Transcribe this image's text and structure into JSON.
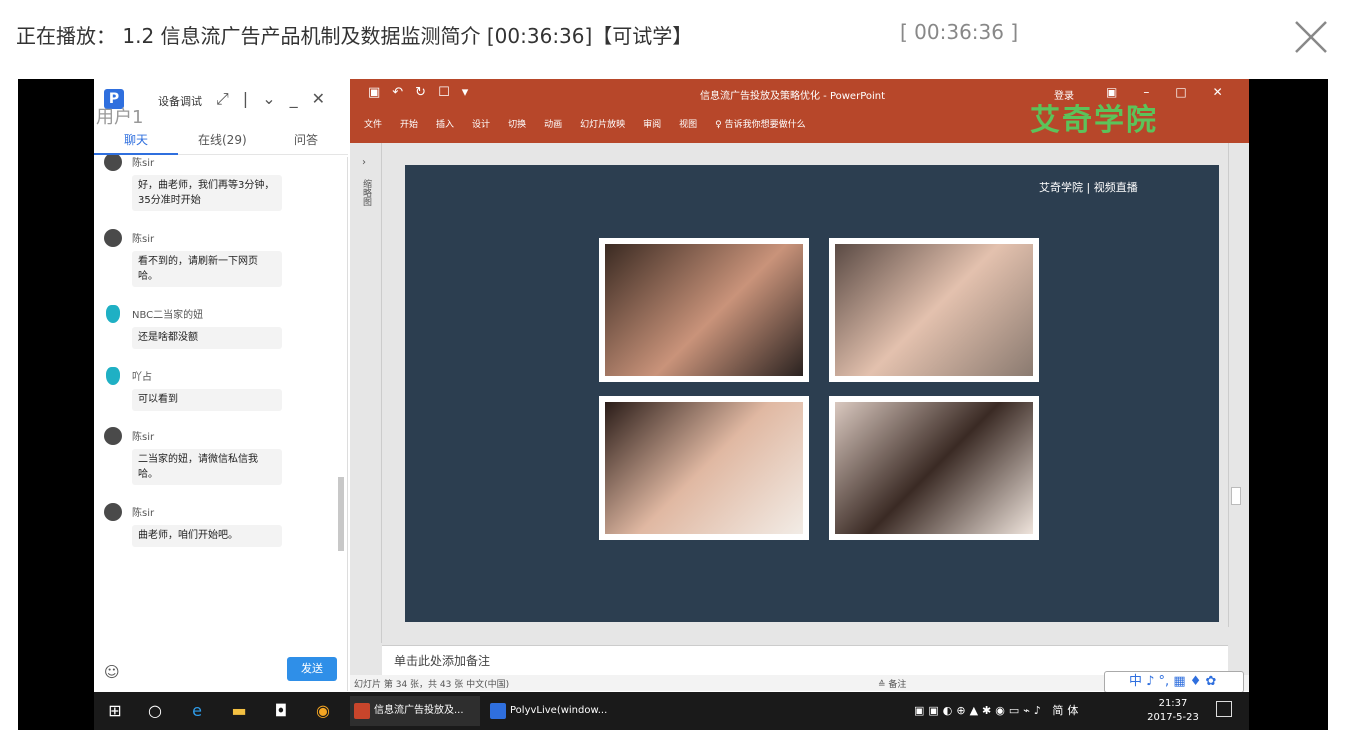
{
  "header": {
    "now_playing": "正在播放： 1.2 信息流广告产品机制及数据监测简介 [00:36:36]【可试学】",
    "duration": "[ 00:36:36 ]"
  },
  "chat": {
    "user_label": "用户1",
    "app_letter": "P",
    "device_test": "设备调试",
    "tabs": [
      {
        "label": "聊天"
      },
      {
        "label": "在线(29)"
      },
      {
        "label": "问答"
      }
    ],
    "messages": [
      {
        "name": "陈sir",
        "text": "好，曲老师，我们再等3分钟，35分准时开始"
      },
      {
        "name": "陈sir",
        "text": "看不到的，请刷新一下网页哈。"
      },
      {
        "name": "NBC二当家的妞",
        "text": "还是啥都没额"
      },
      {
        "name": "吖占",
        "text": "可以看到"
      },
      {
        "name": "陈sir",
        "text": "二当家的妞，请微信私信我哈。"
      },
      {
        "name": "陈sir",
        "text": "曲老师，咱们开始吧。"
      }
    ],
    "send_label": "发送"
  },
  "ppt": {
    "doc_title": "信息流广告投放及策略优化 - PowerPoint",
    "login": "登录",
    "menu": [
      "文件",
      "开始",
      "插入",
      "设计",
      "切换",
      "动画",
      "幻灯片放映",
      "审阅",
      "视图",
      "♀ 告诉我你想要做什么"
    ],
    "watermark": "艾奇学院",
    "left_label": "缩略图",
    "slide_brand": "艾奇学院 | 视频直播",
    "notes_placeholder": "单击此处添加备注",
    "status_left": "幻灯片 第 34 张，共 43 张    中文(中国)",
    "status_right": "≙ 备注",
    "ime_text": "中 ♪ °, ▦ ♦ ✿"
  },
  "taskbar": {
    "tasks": [
      {
        "label": "信息流广告投放及...",
        "color": "#c8452b"
      },
      {
        "label": "PolyvLive(window...",
        "color": "#2f6fde"
      }
    ],
    "ime": "简体",
    "time": "21:37",
    "date": "2017-5-23"
  }
}
